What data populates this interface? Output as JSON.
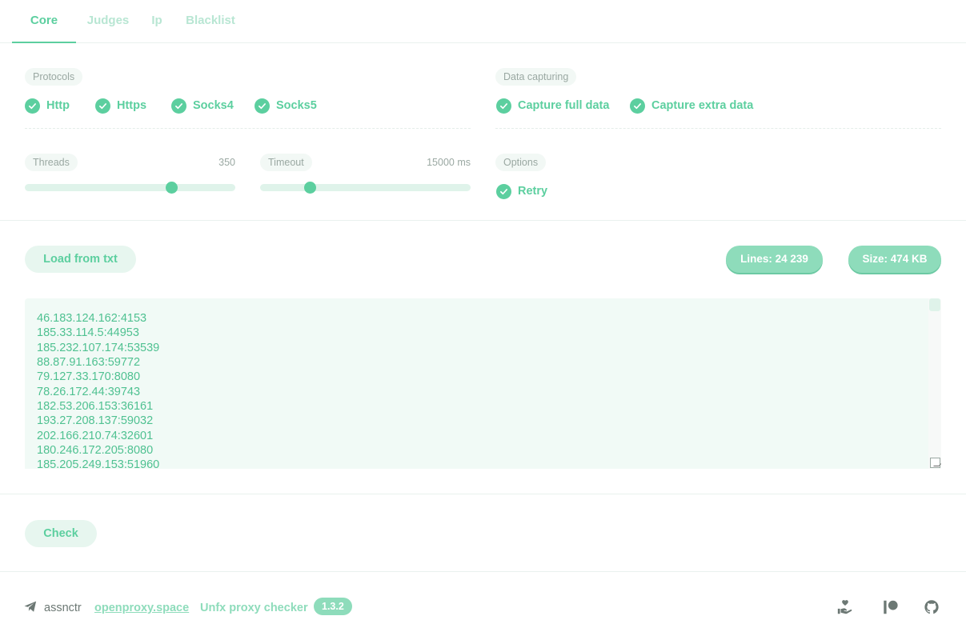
{
  "tabs": [
    {
      "label": "Core",
      "active": true
    },
    {
      "label": "Judges",
      "active": false
    },
    {
      "label": "Ip",
      "active": false
    },
    {
      "label": "Blacklist",
      "active": false
    }
  ],
  "protocols": {
    "label": "Protocols",
    "items": [
      {
        "label": "Http",
        "checked": true
      },
      {
        "label": "Https",
        "checked": true
      },
      {
        "label": "Socks4",
        "checked": true
      },
      {
        "label": "Socks5",
        "checked": true
      }
    ]
  },
  "data_capturing": {
    "label": "Data capturing",
    "items": [
      {
        "label": "Capture full data",
        "checked": true
      },
      {
        "label": "Capture extra data",
        "checked": true
      }
    ]
  },
  "threads": {
    "label": "Threads",
    "value_text": "350",
    "value": 350,
    "min": 1,
    "max": 500
  },
  "timeout": {
    "label": "Timeout",
    "value_text": "15000 ms",
    "value": 15000,
    "min": 1000,
    "max": 60000
  },
  "options": {
    "label": "Options",
    "items": [
      {
        "label": "Retry",
        "checked": true
      }
    ]
  },
  "load_button": "Load from txt",
  "stats": {
    "lines": "Lines: 24 239",
    "size": "Size: 474 KB"
  },
  "proxies": [
    "46.183.124.162:4153",
    "185.33.114.5:44953",
    "185.232.107.174:53539",
    "88.87.91.163:59772",
    "79.127.33.170:8080",
    "78.26.172.44:39743",
    "182.53.206.153:36161",
    "193.27.208.137:59032",
    "202.166.210.74:32601",
    "180.246.172.205:8080",
    "185.205.249.153:51960"
  ],
  "check_button": "Check",
  "footer": {
    "author": "assnctr",
    "site": "openproxy.space",
    "app_name": "Unfx proxy checker",
    "version": "1.3.2",
    "icons": [
      "telegram-icon",
      "donate-icon",
      "patreon-icon",
      "github-icon"
    ]
  },
  "colors": {
    "accent": "#5ccf9f",
    "accent_light": "#8edcbb",
    "muted": "#9aa8a2",
    "bg_soft": "#f1faf6"
  }
}
